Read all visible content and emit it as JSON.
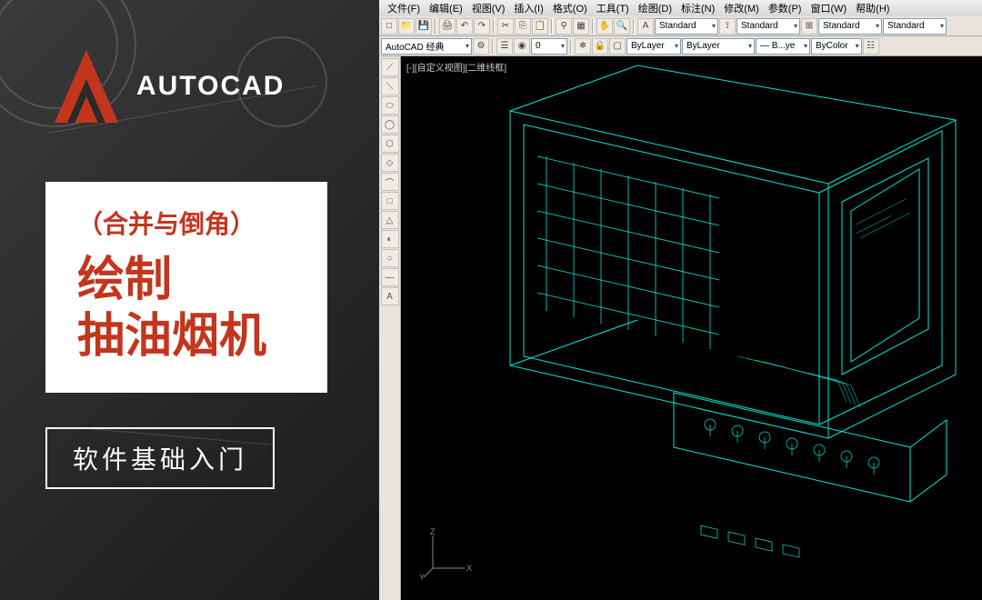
{
  "promo": {
    "logo_text": "AUTOCAD",
    "subtitle": "（合并与倒角）",
    "title_line1": "绘制",
    "title_line2": "抽油烟机",
    "footer": "软件基础入门"
  },
  "cad": {
    "menu": [
      "文件(F)",
      "编辑(E)",
      "视图(V)",
      "插入(I)",
      "格式(O)",
      "工具(T)",
      "绘图(D)",
      "标注(N)",
      "修改(M)",
      "参数(P)",
      "窗口(W)",
      "帮助(H)"
    ],
    "toolbar1": {
      "dropdowns": [
        "Standard",
        "Standard",
        "Standard",
        "Standard"
      ]
    },
    "toolbar2": {
      "workspace": "AutoCAD 经典",
      "layer_zero": "0",
      "layer": "ByLayer",
      "lineweight": "ByLayer",
      "linetype": "— B...ye",
      "color": "ByColor"
    },
    "viewport_label": "[-][自定义视图][二维线框]",
    "ucs_labels": {
      "x": "X",
      "y": "Y",
      "z": "Z"
    },
    "side_tools": [
      "⟋",
      "⟍",
      "⬭",
      "◯",
      "⬡",
      "◇",
      "⌒",
      "□",
      "△",
      "◐",
      "○",
      "—",
      "A"
    ]
  }
}
